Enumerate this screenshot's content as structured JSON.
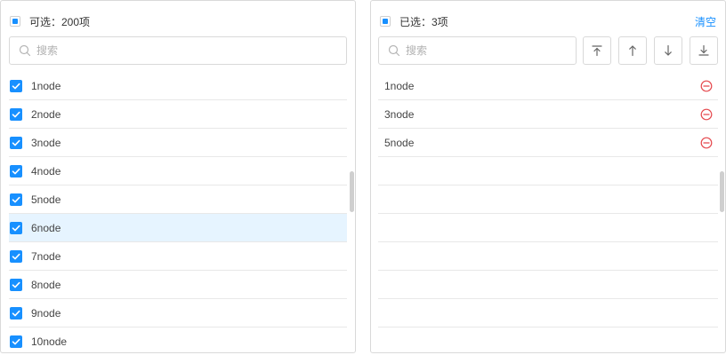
{
  "left_panel": {
    "header": "可选：200项",
    "search_placeholder": "搜索",
    "items": [
      {
        "label": "1node",
        "checked": true
      },
      {
        "label": "2node",
        "checked": true
      },
      {
        "label": "3node",
        "checked": true
      },
      {
        "label": "4node",
        "checked": true
      },
      {
        "label": "5node",
        "checked": true
      },
      {
        "label": "6node",
        "checked": true,
        "hover": true
      },
      {
        "label": "7node",
        "checked": true
      },
      {
        "label": "8node",
        "checked": true
      },
      {
        "label": "9node",
        "checked": true
      },
      {
        "label": "10node",
        "checked": true
      }
    ]
  },
  "right_panel": {
    "header": "已选：3项",
    "clear_label": "清空",
    "search_placeholder": "搜索",
    "sort_buttons": [
      {
        "icon": "arrow-to-top-icon"
      },
      {
        "icon": "arrow-up-icon"
      },
      {
        "icon": "arrow-down-icon"
      },
      {
        "icon": "arrow-to-bottom-icon"
      }
    ],
    "items": [
      {
        "label": "1node"
      },
      {
        "label": "3node"
      },
      {
        "label": "5node"
      }
    ]
  },
  "colors": {
    "accent": "#1890ff",
    "remove": "#e5484d",
    "hover_row": "#e6f4ff",
    "border": "#d9d9d9"
  }
}
